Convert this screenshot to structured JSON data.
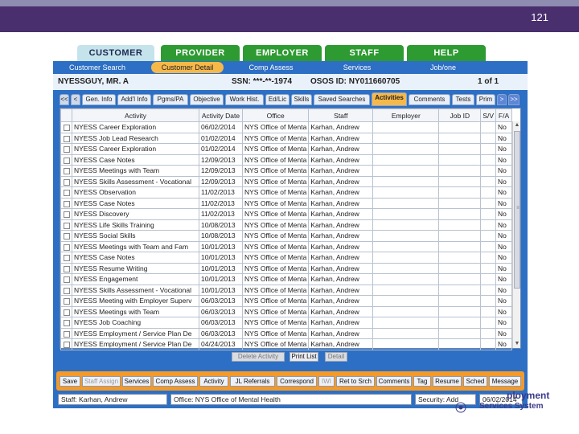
{
  "slide": {
    "number": "121"
  },
  "main_tabs": [
    {
      "label": "CUSTOMER",
      "active": true
    },
    {
      "label": "PROVIDER",
      "active": false
    },
    {
      "label": "EMPLOYER",
      "active": false
    },
    {
      "label": "STAFF",
      "active": false
    },
    {
      "label": "HELP",
      "active": false
    }
  ],
  "sub_nav": [
    {
      "label": "Customer Search",
      "active": false
    },
    {
      "label": "Customer Detail",
      "active": true
    },
    {
      "label": "Comp Assess",
      "active": false
    },
    {
      "label": "Services",
      "active": false
    },
    {
      "label": "Job/one",
      "active": false
    }
  ],
  "customer": {
    "name": "NYESSGUY, MR. A",
    "ssn": "SSN: ***-**-1974",
    "osos_id": "OSOS ID: NY011660705",
    "pager": "1 of 1"
  },
  "detail_tabs": [
    {
      "label": "<<",
      "kind": "nav"
    },
    {
      "label": "<",
      "kind": "nav"
    },
    {
      "label": "Gen. Info",
      "kind": "tab"
    },
    {
      "label": "Add'l Info",
      "kind": "tab"
    },
    {
      "label": "Pgms/PA",
      "kind": "tab"
    },
    {
      "label": "Objective",
      "kind": "tab"
    },
    {
      "label": "Work Hist.",
      "kind": "tab"
    },
    {
      "label": "Ed/Lic",
      "kind": "tab"
    },
    {
      "label": "Skills",
      "kind": "tab"
    },
    {
      "label": "Saved Searches",
      "kind": "tab"
    },
    {
      "label": "Activities",
      "kind": "active"
    },
    {
      "label": "Comments",
      "kind": "tab"
    },
    {
      "label": "Tests",
      "kind": "tab"
    },
    {
      "label": "Prim",
      "kind": "tab"
    },
    {
      "label": ">",
      "kind": "navblue"
    },
    {
      "label": ">>",
      "kind": "navblue"
    }
  ],
  "grid": {
    "columns": [
      "Activity",
      "Activity Date",
      "Office",
      "Staff",
      "Employer",
      "Job ID",
      "S/V",
      "F/A"
    ],
    "rows": [
      [
        "NYESS Career Exploration",
        "06/02/2014",
        "NYS Office of Menta",
        "Karhan, Andrew",
        "",
        "",
        "",
        "No"
      ],
      [
        "NYESS Job Lead Research",
        "01/02/2014",
        "NYS Office of Menta",
        "Karhan, Andrew",
        "",
        "",
        "",
        "No"
      ],
      [
        "NYESS Career Exploration",
        "01/02/2014",
        "NYS Office of Menta",
        "Karhan, Andrew",
        "",
        "",
        "",
        "No"
      ],
      [
        "NYESS Case Notes",
        "12/09/2013",
        "NYS Office of Menta",
        "Karhan, Andrew",
        "",
        "",
        "",
        "No"
      ],
      [
        "NYESS Meetings with Team",
        "12/09/2013",
        "NYS Office of Menta",
        "Karhan, Andrew",
        "",
        "",
        "",
        "No"
      ],
      [
        "NYESS Skills Assessment - Vocational",
        "12/09/2013",
        "NYS Office of Menta",
        "Karhan, Andrew",
        "",
        "",
        "",
        "No"
      ],
      [
        "NYESS Observation",
        "11/02/2013",
        "NYS Office of Menta",
        "Karhan, Andrew",
        "",
        "",
        "",
        "No"
      ],
      [
        "NYESS Case Notes",
        "11/02/2013",
        "NYS Office of Menta",
        "Karhan, Andrew",
        "",
        "",
        "",
        "No"
      ],
      [
        "NYESS Discovery",
        "11/02/2013",
        "NYS Office of Menta",
        "Karhan, Andrew",
        "",
        "",
        "",
        "No"
      ],
      [
        "NYESS Life Skills Training",
        "10/08/2013",
        "NYS Office of Menta",
        "Karhan, Andrew",
        "",
        "",
        "",
        "No"
      ],
      [
        "NYESS Social Skills",
        "10/08/2013",
        "NYS Office of Menta",
        "Karhan, Andrew",
        "",
        "",
        "",
        "No"
      ],
      [
        "NYESS Meetings with Team and Fam",
        "10/01/2013",
        "NYS Office of Menta",
        "Karhan, Andrew",
        "",
        "",
        "",
        "No"
      ],
      [
        "NYESS Case Notes",
        "10/01/2013",
        "NYS Office of Menta",
        "Karhan, Andrew",
        "",
        "",
        "",
        "No"
      ],
      [
        "NYESS Resume Writing",
        "10/01/2013",
        "NYS Office of Menta",
        "Karhan, Andrew",
        "",
        "",
        "",
        "No"
      ],
      [
        "NYESS Engagement",
        "10/01/2013",
        "NYS Office of Menta",
        "Karhan, Andrew",
        "",
        "",
        "",
        "No"
      ],
      [
        "NYESS Skills Assessment - Vocational",
        "10/01/2013",
        "NYS Office of Menta",
        "Karhan, Andrew",
        "",
        "",
        "",
        "No"
      ],
      [
        "NYESS Meeting with Employer Superv",
        "06/03/2013",
        "NYS Office of Menta",
        "Karhan, Andrew",
        "",
        "",
        "",
        "No"
      ],
      [
        "NYESS Meetings with Team",
        "06/03/2013",
        "NYS Office of Menta",
        "Karhan, Andrew",
        "",
        "",
        "",
        "No"
      ],
      [
        "NYESS Job Coaching",
        "06/03/2013",
        "NYS Office of Menta",
        "Karhan, Andrew",
        "",
        "",
        "",
        "No"
      ],
      [
        "NYESS Employment / Service Plan De",
        "06/03/2013",
        "NYS Office of Menta",
        "Karhan, Andrew",
        "",
        "",
        "",
        "No"
      ],
      [
        "NYESS Employment / Service Plan De",
        "04/24/2013",
        "NYS Office of Menta",
        "Karhan, Andrew",
        "",
        "",
        "",
        "No"
      ]
    ]
  },
  "grid_actions": [
    {
      "label": "Delete Activity",
      "enabled": false
    },
    {
      "label": "Print List",
      "enabled": true
    },
    {
      "label": "Detail",
      "enabled": false
    }
  ],
  "bottom_buttons": [
    {
      "label": "Save",
      "enabled": true
    },
    {
      "label": "Staff Assign",
      "enabled": false
    },
    {
      "label": "Services",
      "enabled": true
    },
    {
      "label": "Comp Assess",
      "enabled": true
    },
    {
      "label": "Activity",
      "enabled": true
    },
    {
      "label": "JL Referrals",
      "enabled": true
    },
    {
      "label": "Correspond",
      "enabled": true
    },
    {
      "label": "IWI",
      "enabled": false
    },
    {
      "label": "Ret to Srch",
      "enabled": true
    },
    {
      "label": "Comments",
      "enabled": true
    },
    {
      "label": "Tag",
      "enabled": true
    },
    {
      "label": "Resume",
      "enabled": true
    },
    {
      "label": "Sched",
      "enabled": true
    },
    {
      "label": "Message",
      "enabled": true
    }
  ],
  "status": {
    "staff": "Staff: Karhan, Andrew",
    "office": "Office: NYS Office of Mental Health",
    "security": "Security: Add",
    "date": "06/02/2014"
  },
  "logo": {
    "line1": "ployment",
    "line2": "Services System"
  },
  "colors": {
    "header": "#4a2f6e",
    "main_tab": "#2e9a32",
    "nav_blue": "#2c6fc4",
    "accent_orange": "#f39a2a",
    "active_tab": "#f7b84a"
  }
}
